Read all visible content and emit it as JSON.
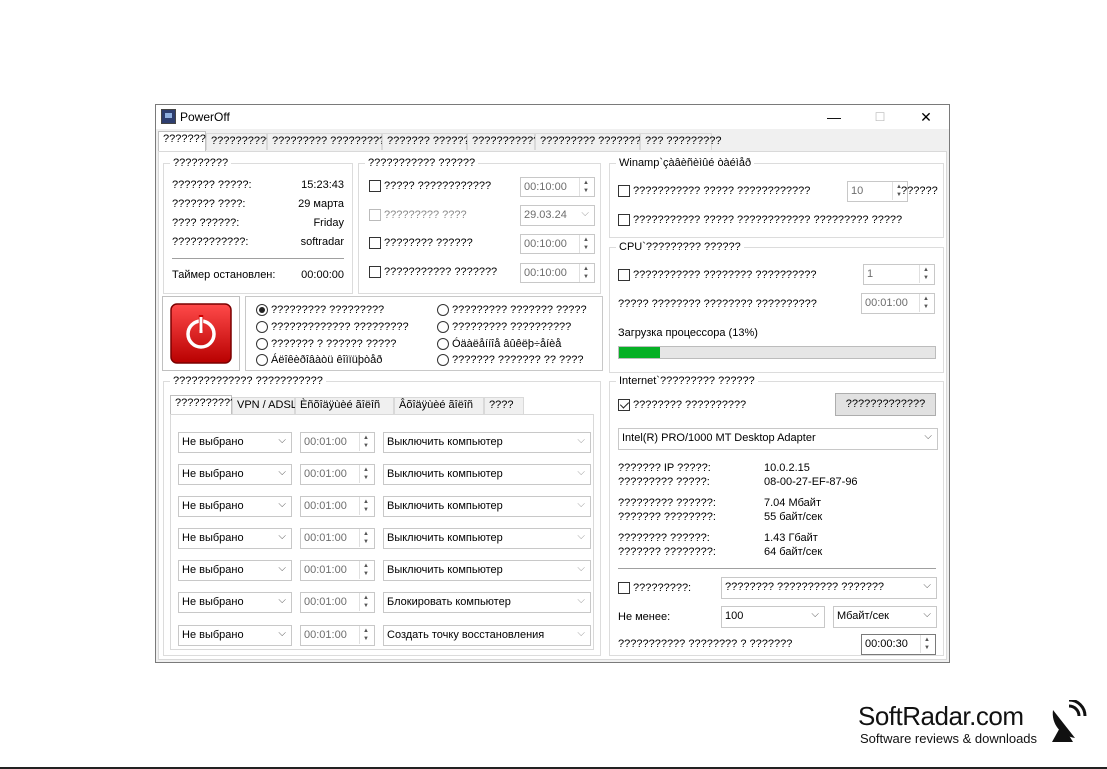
{
  "window": {
    "title": "PowerOff",
    "minimize": "—",
    "maximize": "☐",
    "close": "✕"
  },
  "tabs": [
    "???????",
    "??????????",
    "????????? ???????????",
    "??????? ???????",
    "???????????",
    "????????? ?????????",
    "??? ?????????"
  ],
  "info": {
    "title": "?????????",
    "rows": [
      {
        "label": "??????? ?????:",
        "value": "15:23:43"
      },
      {
        "label": "??????? ????:",
        "value": "29 марта"
      },
      {
        "label": "???? ??????:",
        "value": "Friday"
      },
      {
        "label": "????????????:",
        "value": "softradar"
      }
    ],
    "timer_label": "Таймер остановлен:",
    "timer_value": "00:00:00"
  },
  "schedule": {
    "title": "??????????? ??????",
    "rows": [
      {
        "label": "????? ????????????",
        "value": "00:10:00",
        "checked": false
      },
      {
        "label": "????????? ????",
        "value": "29.03.24",
        "checked": false
      },
      {
        "label": "???????? ??????",
        "value": "00:10:00",
        "checked": false
      },
      {
        "label": "??????????? ???????",
        "value": "00:10:00",
        "checked": false
      }
    ]
  },
  "actions": {
    "col1": [
      "????????? ?????????",
      "????????????? ?????????",
      "??????? ? ?????? ?????",
      "Áëîêèðîâàòü êîìïüþòåð"
    ],
    "col2": [
      "????????? ??????? ?????",
      "????????? ??????????",
      "Óäàëåííîå âûêëþ÷åíèå",
      "??????? ??????? ?? ????"
    ],
    "selected": 0
  },
  "winamp": {
    "title": "Winamp`çàâèñèìûé òàéìåð",
    "row1_label": "??????????? ????? ????????????",
    "row1_value": "10",
    "row1_suffix": "??????",
    "row2_label": "??????????? ????? ???????????? ????????? ?????"
  },
  "cpu": {
    "title": "CPU`????????? ??????",
    "row1_label": "??????????? ???????? ??????????",
    "row1_value": "1",
    "row2_label": "????? ???????? ???????? ??????????",
    "row2_value": "00:01:00",
    "load_label": "Загрузка процессора (13%)",
    "load_percent": 13
  },
  "scheduler": {
    "title": "????????????? ???????????",
    "subtabs": [
      "??????????",
      "VPN / ADSL",
      "Èñõîäÿùèé ãîëîñ",
      "Âõîäÿùèé ãîëîñ",
      "????"
    ],
    "rows": [
      {
        "day": "Не выбрано",
        "time": "00:01:00",
        "action": "Выключить компьютер"
      },
      {
        "day": "Не выбрано",
        "time": "00:01:00",
        "action": "Выключить компьютер"
      },
      {
        "day": "Не выбрано",
        "time": "00:01:00",
        "action": "Выключить компьютер"
      },
      {
        "day": "Не выбрано",
        "time": "00:01:00",
        "action": "Выключить компьютер"
      },
      {
        "day": "Не выбрано",
        "time": "00:01:00",
        "action": "Выключить компьютер"
      },
      {
        "day": "Не выбрано",
        "time": "00:01:00",
        "action": "Блокировать компьютер"
      },
      {
        "day": "Не выбрано",
        "time": "00:01:00",
        "action": "Создать точку восстановления"
      }
    ]
  },
  "internet": {
    "title": "Internet`????????? ??????",
    "monitor_label": "???????? ??????????",
    "monitor_checked": true,
    "button_label": "?????????????",
    "adapter": "Intel(R) PRO/1000 MT Desktop Adapter",
    "stats": [
      {
        "label": "??????? IP ?????:",
        "value": "10.0.2.15"
      },
      {
        "label": "????????? ?????:",
        "value": "08-00-27-EF-87-96"
      },
      {
        "label": "????????? ??????:",
        "value": "7.04 Мбайт"
      },
      {
        "label": "??????? ????????:",
        "value": "55 байт/сек"
      },
      {
        "label": "???????? ??????:",
        "value": "1.43 Гбайт"
      },
      {
        "label": "??????? ????????:",
        "value": "64 байт/сек"
      }
    ],
    "cond_label": "?????????:",
    "cond_value": "???????? ?????????? ???????",
    "min_label": "Не менее:",
    "min_value": "100",
    "unit_value": "Мбайт/сек",
    "duration_label": "??????????? ???????? ? ???????",
    "duration_value": "00:00:30"
  },
  "watermark": {
    "title": "SoftRadar.com",
    "subtitle": "Software reviews & downloads"
  }
}
